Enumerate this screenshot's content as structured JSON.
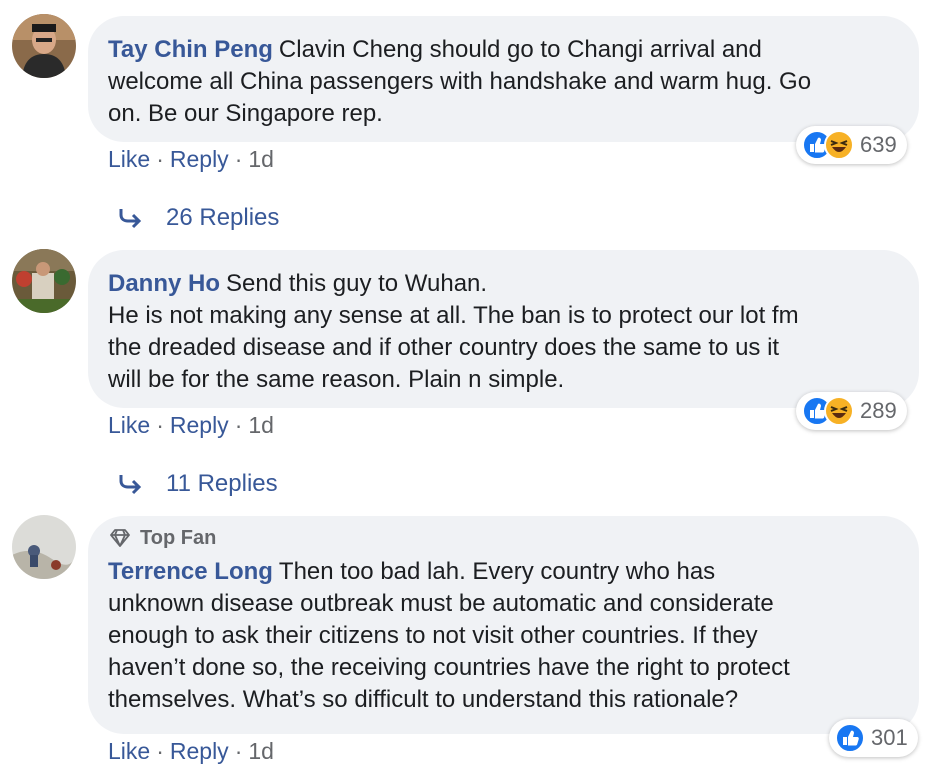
{
  "colors": {
    "link": "#385898",
    "bubble": "#f0f2f5",
    "meta": "#65676b",
    "like_blue": "#1877f2",
    "haha_yellow": "#f7b125"
  },
  "comments": [
    {
      "author": "Tay Chin Peng",
      "text": "Clavin Cheng should go to Changi arrival and\nwelcome all China passengers with handshake and warm hug. Go\non. Be our Singapore rep.",
      "reactions": [
        "like-icon",
        "haha-icon"
      ],
      "reaction_count": "639",
      "like_label": "Like",
      "reply_label": "Reply",
      "separator": "·",
      "time": "1d",
      "replies_label": "26 Replies"
    },
    {
      "author": "Danny Ho",
      "text": "Send this guy to Wuhan.\nHe is not making any sense at all. The ban is to protect our lot fm\nthe dreaded disease and if other country does the same to us it\nwill be for the same reason. Plain n simple.",
      "reactions": [
        "like-icon",
        "haha-icon"
      ],
      "reaction_count": "289",
      "like_label": "Like",
      "reply_label": "Reply",
      "separator": "·",
      "time": "1d",
      "replies_label": "11 Replies"
    },
    {
      "badge": "Top Fan",
      "author": "Terrence Long",
      "text": "Then too bad lah. Every country who has\nunknown disease outbreak must be automatic and considerate\nenough to ask their citizens to not visit other countries. If they\nhaven’t done so, the receiving countries have the right to protect\nthemselves. What’s so difficult to understand this rationale?",
      "reactions": [
        "like-icon"
      ],
      "reaction_count": "301",
      "like_label": "Like",
      "reply_label": "Reply",
      "separator": "·",
      "time": "1d"
    }
  ]
}
